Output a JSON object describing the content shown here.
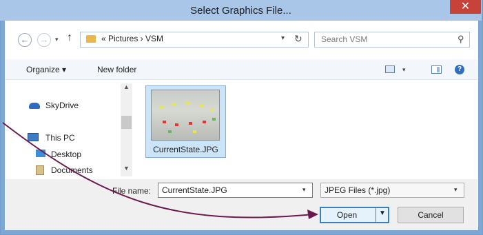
{
  "window": {
    "title": "Select Graphics File...",
    "close_glyph": "✕"
  },
  "address": {
    "back_glyph": "←",
    "forward_glyph": "→",
    "dropdown_glyph": "▾",
    "up_glyph": "↑",
    "breadcrumb": "«  Pictures  ›  VSM",
    "refresh_glyph": "↻",
    "search_placeholder": "Search VSM",
    "search_glyph": "⚲"
  },
  "toolbar": {
    "organize": "Organize ▾",
    "new_folder": "New folder",
    "view_dropdown": "▾",
    "help": "?"
  },
  "nav": {
    "items": [
      {
        "label": "SkyDrive",
        "icon": "cloud-icon"
      },
      {
        "label": "This PC",
        "icon": "computer-icon"
      },
      {
        "label": "Desktop",
        "icon": "desktop-folder-icon"
      },
      {
        "label": "Documents",
        "icon": "documents-folder-icon"
      }
    ],
    "scroll_up": "▲",
    "scroll_down": "▼"
  },
  "files": [
    {
      "name": "CurrentState.JPG",
      "selected": true
    }
  ],
  "footer": {
    "file_name_label": "File name:",
    "file_name_value": "CurrentState.JPG",
    "file_name_dropdown": "▾",
    "file_type": "JPEG Files (*.jpg)",
    "file_type_dropdown": "▾",
    "open": "Open",
    "open_dropdown": "▼",
    "cancel": "Cancel"
  },
  "colors": {
    "accent": "#3c7fb1",
    "annotation_arrow": "#6b1a4e",
    "selection": "#cce4f7",
    "close": "#c7433a"
  }
}
